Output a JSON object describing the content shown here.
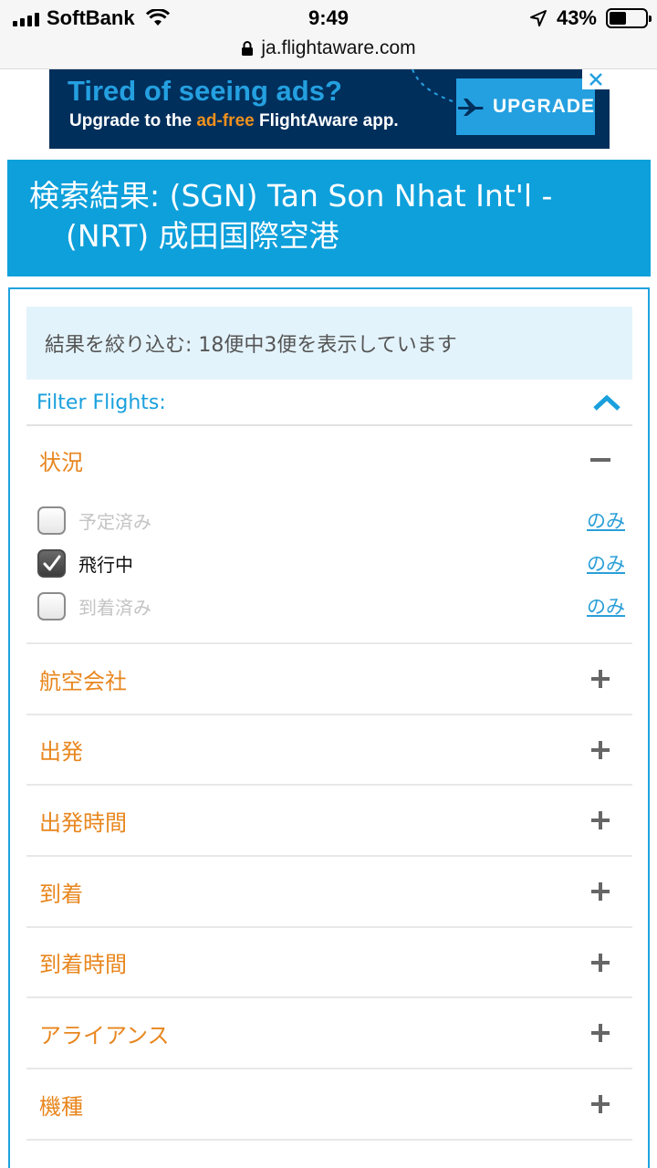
{
  "status_bar": {
    "carrier": "SoftBank",
    "time": "9:49",
    "battery": "43%",
    "battery_level": 0.43,
    "url": "ja.flightaware.com"
  },
  "ad": {
    "title": "Tired of seeing ads?",
    "subtitle_prefix": "Upgrade to the ",
    "subtitle_highlight": "ad-free",
    "subtitle_suffix": " FlightAware app.",
    "button_label": "UPGRADE",
    "colors": {
      "background": "#002f5c",
      "accent": "#24a0e0",
      "highlight": "#f0901c"
    }
  },
  "header": {
    "title": "検索結果: (SGN) Tan Son Nhat Int'l - (NRT) 成田国際空港"
  },
  "filter": {
    "result_text": "結果を絞り込む: 18便中3便を表示しています",
    "title": "Filter Flights:",
    "status_section": {
      "label": "状況",
      "options": [
        {
          "label": "予定済み",
          "checked": false,
          "only": "のみ"
        },
        {
          "label": "飛行中",
          "checked": true,
          "only": "のみ"
        },
        {
          "label": "到着済み",
          "checked": false,
          "only": "のみ"
        }
      ]
    },
    "sections": [
      {
        "label": "航空会社"
      },
      {
        "label": "出発"
      },
      {
        "label": "出発時間"
      },
      {
        "label": "到着"
      },
      {
        "label": "到着時間"
      },
      {
        "label": "アライアンス"
      },
      {
        "label": "機種"
      }
    ]
  },
  "colors": {
    "brand_blue": "#0ea0db",
    "section_orange": "#e8861e",
    "link_blue": "#2a9fd8"
  }
}
